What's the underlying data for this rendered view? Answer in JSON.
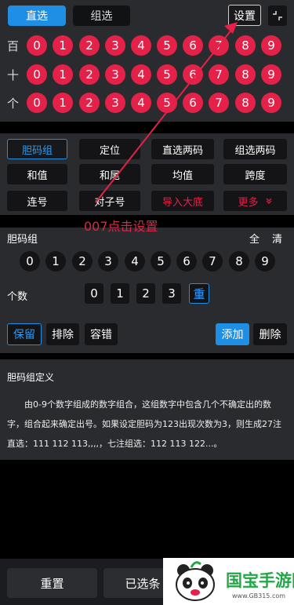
{
  "header": {
    "tab_direct": "直选",
    "tab_group": "组选",
    "settings": "设置",
    "collapse_icon": "collapse-icon"
  },
  "rows": [
    {
      "label": "百",
      "numbers": [
        "0",
        "1",
        "2",
        "3",
        "4",
        "5",
        "6",
        "7",
        "8",
        "9"
      ]
    },
    {
      "label": "十",
      "numbers": [
        "0",
        "1",
        "2",
        "3",
        "4",
        "5",
        "6",
        "7",
        "8",
        "9"
      ]
    },
    {
      "label": "个",
      "numbers": [
        "0",
        "1",
        "2",
        "3",
        "4",
        "5",
        "6",
        "7",
        "8",
        "9"
      ]
    }
  ],
  "filters": [
    [
      "胆码组",
      "定位",
      "直选两码",
      "组选两码"
    ],
    [
      "和值",
      "和尾",
      "均值",
      "跨度"
    ],
    [
      "连号",
      "对子号",
      "导入大底",
      "更多"
    ]
  ],
  "annotation": "007点击设置",
  "danma": {
    "title": "胆码组",
    "select_all": "全",
    "clear": "清",
    "digits": [
      "0",
      "1",
      "2",
      "3",
      "4",
      "5",
      "6",
      "7",
      "8",
      "9"
    ],
    "count_label": "个数",
    "counts": [
      "0",
      "1",
      "2",
      "3",
      "重"
    ]
  },
  "actions": {
    "keep": "保留",
    "exclude": "排除",
    "tolerance": "容错",
    "add": "添加",
    "delete": "删除"
  },
  "definition": {
    "title": "胆码组定义",
    "text": "由0-9个数字组成的数字组合，这组数字中包含几个不确定出的数字，组合起来确定出号。如果设定胆码为123出现次数为3，则生成27注直选：111 112 113,,,,，七注组选：112 113 122...。"
  },
  "bottom": {
    "reset": "重置",
    "selected": "已选条"
  },
  "logo": {
    "name": "国宝手游网",
    "url": "www.GB315.com"
  },
  "colors": {
    "accent_blue": "#1f8fe6",
    "ball_red": "#e42149",
    "panel": "#2a2b2f",
    "annotation_red": "#e42149"
  }
}
